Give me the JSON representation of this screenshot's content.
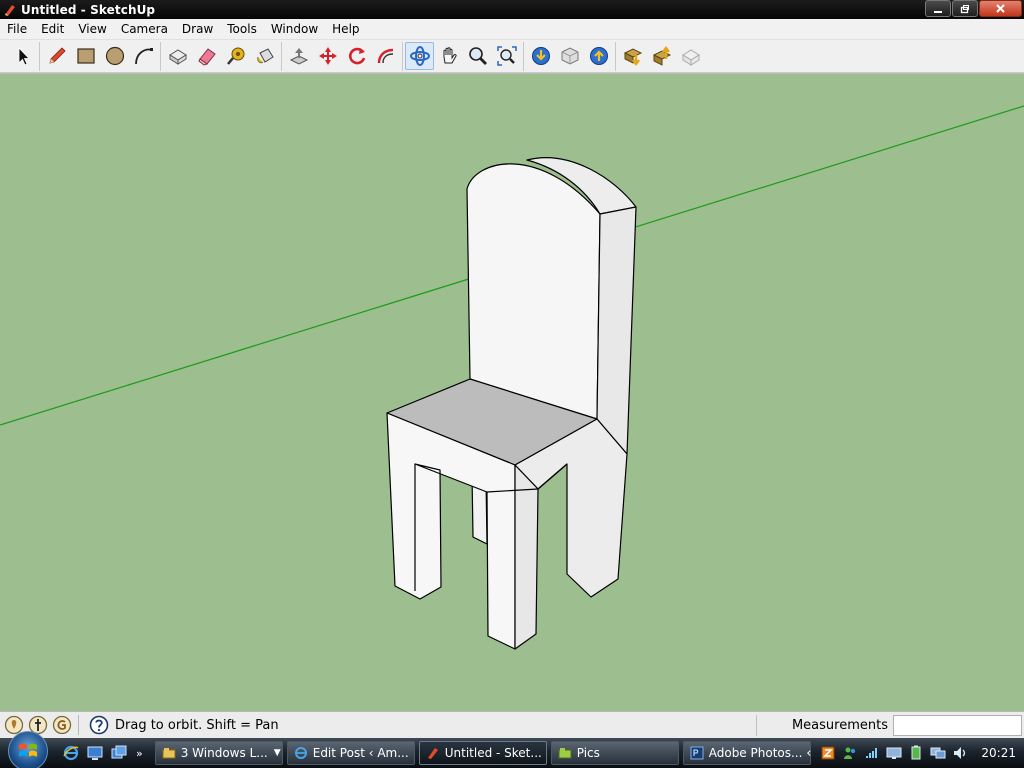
{
  "window": {
    "title": "Untitled - SketchUp",
    "icon": "sketchup-logo-icon"
  },
  "menu": [
    "File",
    "Edit",
    "View",
    "Camera",
    "Draw",
    "Tools",
    "Window",
    "Help"
  ],
  "toolbar": {
    "tools": [
      {
        "name": "select-tool-icon",
        "group": 0
      },
      {
        "name": "pencil-tool-icon",
        "group": 1
      },
      {
        "name": "rectangle-tool-icon",
        "group": 1
      },
      {
        "name": "circle-tool-icon",
        "group": 1
      },
      {
        "name": "arc-tool-icon",
        "group": 1
      },
      {
        "name": "make-component-icon",
        "group": 2
      },
      {
        "name": "eraser-tool-icon",
        "group": 2
      },
      {
        "name": "tape-measure-icon",
        "group": 2
      },
      {
        "name": "paint-bucket-icon",
        "group": 2
      },
      {
        "name": "push-pull-icon",
        "group": 3
      },
      {
        "name": "move-tool-icon",
        "group": 3
      },
      {
        "name": "rotate-tool-icon",
        "group": 3
      },
      {
        "name": "offset-tool-icon",
        "group": 3
      },
      {
        "name": "orbit-tool-icon",
        "group": 4,
        "active": true
      },
      {
        "name": "pan-tool-icon",
        "group": 4
      },
      {
        "name": "zoom-tool-icon",
        "group": 4
      },
      {
        "name": "zoom-extents-icon",
        "group": 4
      },
      {
        "name": "get-models-icon",
        "group": 5
      },
      {
        "name": "share-model-icon",
        "group": 5
      },
      {
        "name": "google-earth-icon",
        "group": 5
      },
      {
        "name": "get-current-view-icon",
        "group": 6
      },
      {
        "name": "place-model-icon",
        "group": 6
      },
      {
        "name": "toggle-terrain-icon",
        "group": 6
      }
    ]
  },
  "statusbar": {
    "hint": "Drag to orbit.  Shift = Pan",
    "measurements_label": "Measurements",
    "measurements_value": ""
  },
  "taskbar": {
    "buttons": [
      {
        "label": "3 Windows L...",
        "icon": "windows-explorer-icon",
        "dropdown": true
      },
      {
        "label": "Edit Post ‹ Am...",
        "icon": "internet-explorer-icon"
      },
      {
        "label": "Untitled - Sket...",
        "icon": "sketchup-logo-icon",
        "active": true
      },
      {
        "label": "Pics",
        "icon": "folder-icon"
      },
      {
        "label": "Adobe Photos...",
        "icon": "photoshop-icon"
      }
    ],
    "clock": "20:21"
  },
  "colors": {
    "viewport_background": "#9dbf8f",
    "axis_green": "#1f9a1f",
    "chair_face_light": "#f4f4f4",
    "chair_face_side": "#e6e6e6",
    "chair_seat": "#bdbdbd",
    "edge": "#000000"
  }
}
